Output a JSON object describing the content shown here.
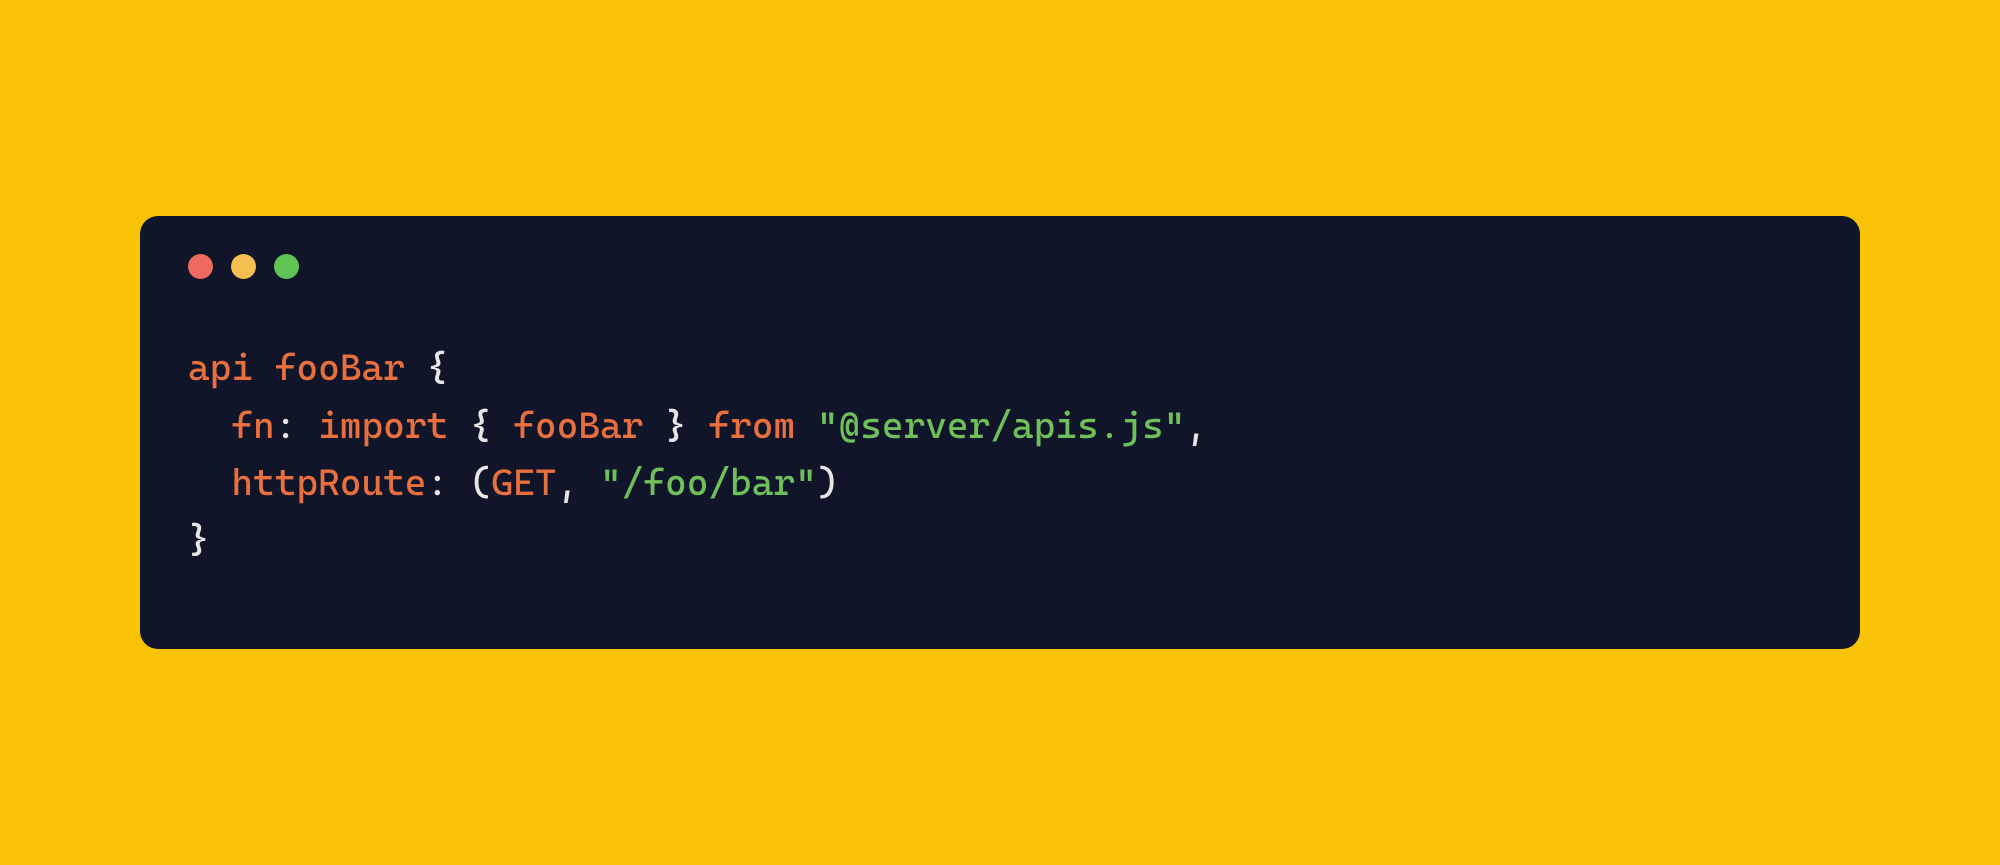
{
  "colors": {
    "background": "#f8c307",
    "window": "#101529",
    "traffic_red": "#ee6a5e",
    "traffic_yellow": "#f4be50",
    "traffic_green": "#5fc454",
    "syntax_keyword": "#e86f3e",
    "syntax_string": "#6fbf5a",
    "syntax_punct": "#e6e6e6"
  },
  "code": {
    "line1": {
      "keyword_api": "api",
      "name": "fooBar",
      "brace_open": "{"
    },
    "line2": {
      "prop_fn": "fn",
      "colon1": ":",
      "keyword_import": "import",
      "brace_l": "{",
      "import_name": "fooBar",
      "brace_r": "}",
      "keyword_from": "from",
      "string_path": "\"@server/apis.js\"",
      "comma": ","
    },
    "line3": {
      "prop_httpRoute": "httpRoute",
      "colon2": ":",
      "paren_l": "(",
      "method": "GET",
      "comma2": ",",
      "string_route": "\"/foo/bar\"",
      "paren_r": ")"
    },
    "line4": {
      "brace_close": "}"
    }
  }
}
